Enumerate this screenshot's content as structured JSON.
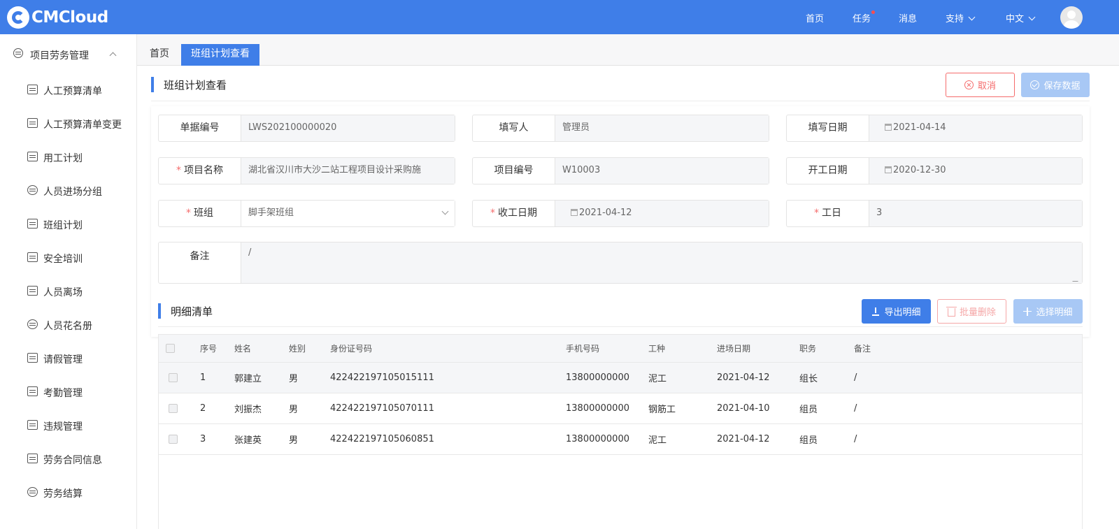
{
  "header": {
    "logo_text": "CMCloud",
    "nav": {
      "home": "首页",
      "tasks": "任务",
      "messages": "消息",
      "support": "支持",
      "language": "中文"
    }
  },
  "sidebar": {
    "group_label": "项目劳务管理",
    "items": [
      {
        "label": "人工预算清单",
        "icon": "table-icon"
      },
      {
        "label": "人工预算清单变更",
        "icon": "card-change-icon"
      },
      {
        "label": "用工计划",
        "icon": "plan-doc-icon"
      },
      {
        "label": "人员进场分组",
        "icon": "person-icon"
      },
      {
        "label": "班组计划",
        "icon": "org-chart-icon"
      },
      {
        "label": "安全培训",
        "icon": "training-icon"
      },
      {
        "label": "人员离场",
        "icon": "exit-icon"
      },
      {
        "label": "人员花名册",
        "icon": "group-icon"
      },
      {
        "label": "请假管理",
        "icon": "layers-icon"
      },
      {
        "label": "考勤管理",
        "icon": "attendance-icon"
      },
      {
        "label": "违规管理",
        "icon": "clipboard-check-icon"
      },
      {
        "label": "劳务合同信息",
        "icon": "contract-icon"
      },
      {
        "label": "劳务结算",
        "icon": "coins-icon"
      }
    ]
  },
  "tabs": {
    "home": "首页",
    "active": "班组计划查看"
  },
  "page": {
    "title": "班组计划查看",
    "cancel_label": "取消",
    "save_label": "保存数据"
  },
  "form": {
    "doc_no": {
      "label": "单据编号",
      "value": "LWS202100000020"
    },
    "filler": {
      "label": "填写人",
      "value": "管理员"
    },
    "fill_date": {
      "label": "填写日期",
      "value": "2021-04-14"
    },
    "project_name": {
      "label": "项目名称",
      "value": "湖北省汉川市大沙二站工程项目设计采购施"
    },
    "project_no": {
      "label": "项目编号",
      "value": "W10003"
    },
    "start_date": {
      "label": "开工日期",
      "value": "2020-12-30"
    },
    "team": {
      "label": "班组",
      "value": "脚手架班组"
    },
    "end_date": {
      "label": "收工日期",
      "value": "2021-04-12"
    },
    "workdays": {
      "label": "工日",
      "value": "3"
    },
    "remark": {
      "label": "备注",
      "value": "/"
    }
  },
  "detail": {
    "title": "明细清单",
    "export_label": "导出明细",
    "batch_delete_label": "批量删除",
    "select_label": "选择明细",
    "columns": [
      "序号",
      "姓名",
      "姓别",
      "身份证号码",
      "手机号码",
      "工种",
      "进场日期",
      "职务",
      "备注"
    ],
    "rows": [
      [
        "1",
        "郭建立",
        "男",
        "422422197105015111",
        "13800000000",
        "泥工",
        "2021-04-12",
        "组长",
        "/"
      ],
      [
        "2",
        "刘振杰",
        "男",
        "422422197105070111",
        "13800000000",
        "钢筋工",
        "2021-04-10",
        "组员",
        "/"
      ],
      [
        "3",
        "张建英",
        "男",
        "422422197105060851",
        "13800000000",
        "泥工",
        "2021-04-12",
        "组员",
        "/"
      ]
    ]
  },
  "colors": {
    "primary": "#3f7ee8",
    "danger": "#f56c6c",
    "disabled_primary": "#a8c8f5"
  }
}
